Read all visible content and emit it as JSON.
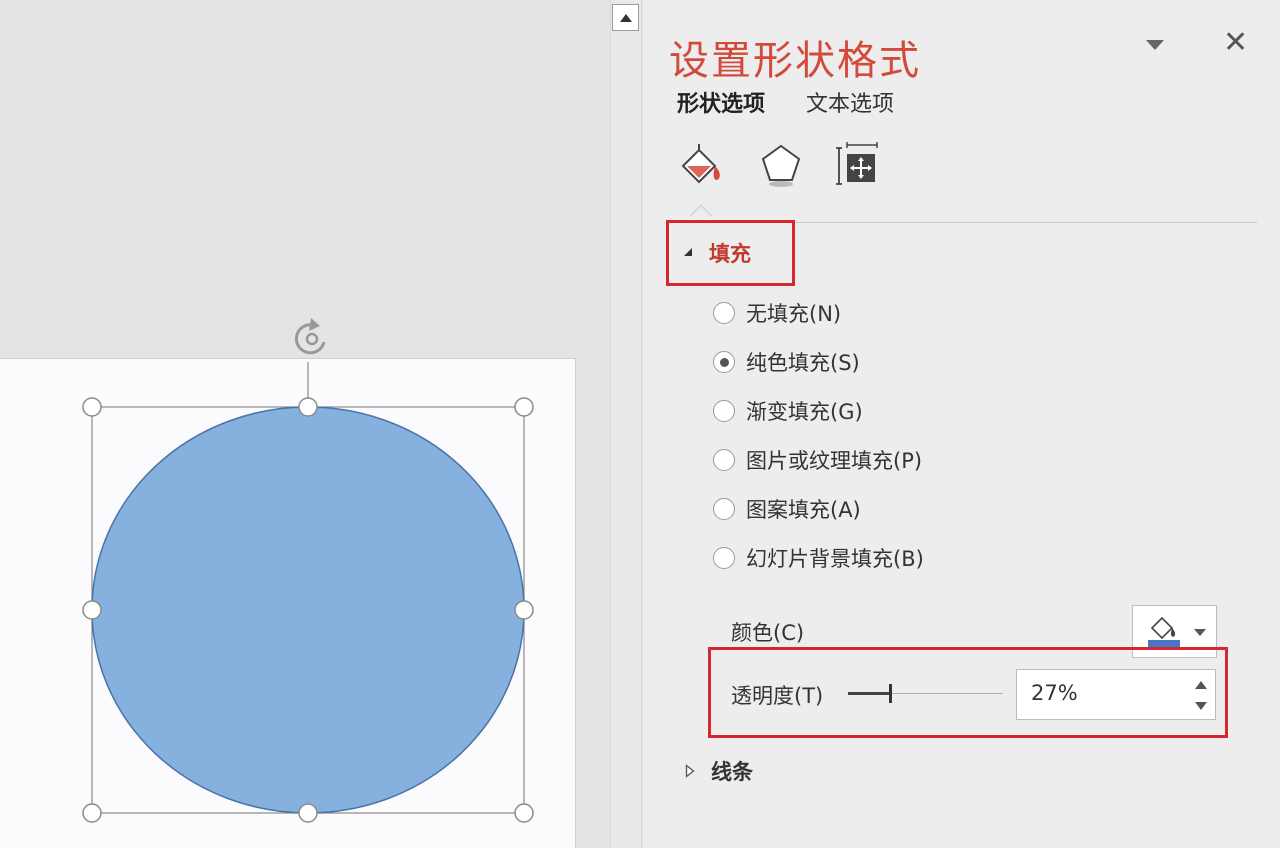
{
  "pane": {
    "title": "设置形状格式",
    "tabs": [
      {
        "label": "形状选项",
        "active": true
      },
      {
        "label": "文本选项",
        "active": false
      }
    ],
    "sections": {
      "fill": {
        "label": "填充",
        "options": [
          {
            "label": "无填充(N)",
            "checked": false
          },
          {
            "label": "纯色填充(S)",
            "checked": true
          },
          {
            "label": "渐变填充(G)",
            "checked": false
          },
          {
            "label": "图片或纹理填充(P)",
            "checked": false
          },
          {
            "label": "图案填充(A)",
            "checked": false
          },
          {
            "label": "幻灯片背景填充(B)",
            "checked": false
          }
        ],
        "color_label": "颜色(C)",
        "transparency_label": "透明度(T)",
        "transparency_value": "27%",
        "transparency_fraction": 0.27
      },
      "line": {
        "label": "线条"
      }
    }
  },
  "colors": {
    "shape_fill": "#86b0dd",
    "shape_stroke": "#4a74a8",
    "accent": "#d24b3a",
    "highlight": "#d7262d"
  },
  "icons": [
    "rotate-handle-icon",
    "fill-bucket-icon",
    "pentagon-effects-icon",
    "size-position-icon",
    "close-icon",
    "dropdown-icon"
  ]
}
